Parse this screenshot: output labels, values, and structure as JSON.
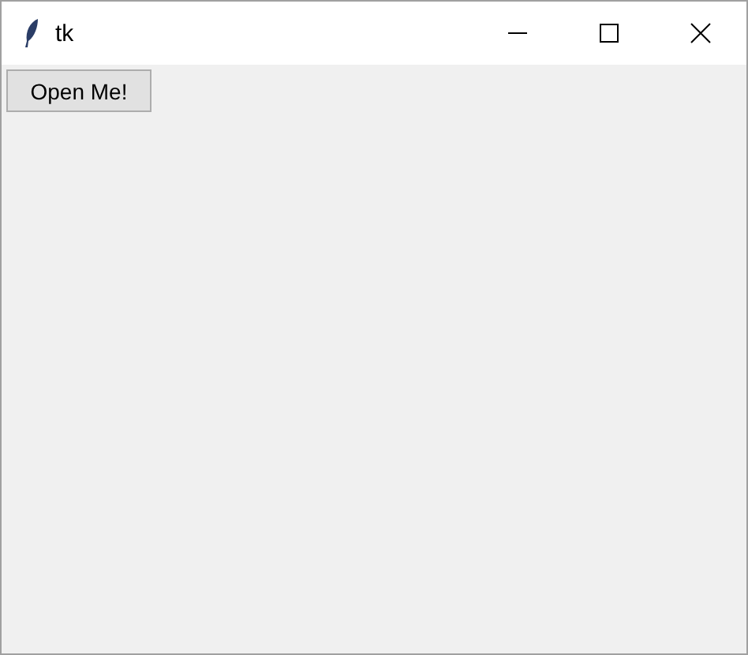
{
  "window": {
    "title": "tk"
  },
  "button": {
    "label": "Open Me!"
  }
}
